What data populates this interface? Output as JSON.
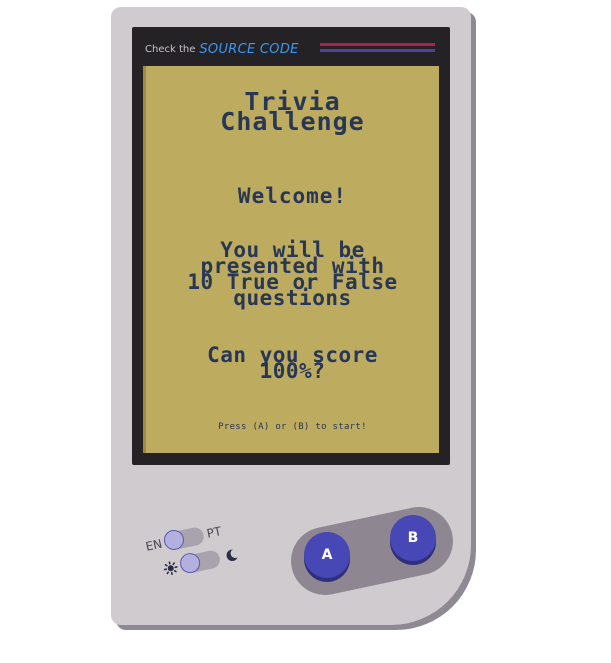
{
  "header": {
    "source_prefix": "Check the",
    "source_link": "SOURCE CODE"
  },
  "screen": {
    "title_line1": "Trivia",
    "title_line2": "Challenge",
    "welcome": "Welcome!",
    "description_lines": [
      "You will be",
      "presented with",
      "10 True or False",
      "questions"
    ],
    "question_lines": [
      "Can you score",
      "100%?"
    ],
    "start_prompt": "Press (A) or (B) to start!"
  },
  "controls": {
    "lang_left": "EN",
    "lang_right": "PT",
    "theme_left_icon": "sun-icon",
    "theme_right_icon": "moon-icon",
    "button_a": "A",
    "button_b": "B"
  },
  "colors": {
    "console": "#cfcbcf",
    "lcd": "#bdab60",
    "lcd_text": "#283755",
    "link": "#3b97f2",
    "buttons": "#4747b6"
  }
}
